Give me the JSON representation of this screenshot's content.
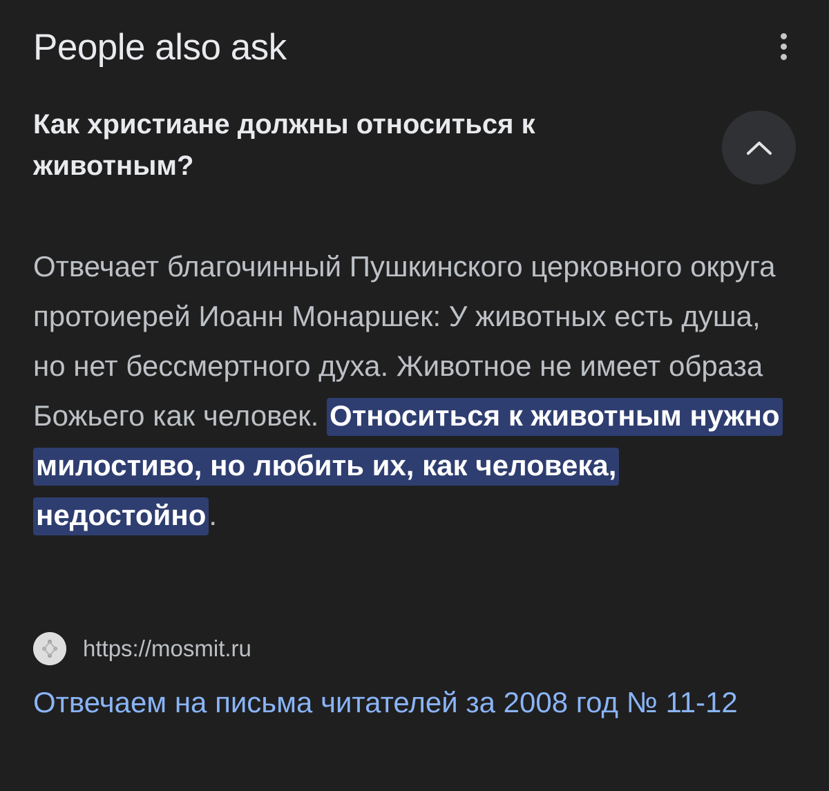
{
  "header": {
    "title": "People also ask",
    "more_icon": "more-vert-icon"
  },
  "question": {
    "text": "Как христиане должны относиться к животным?",
    "toggle_icon": "chevron-up-icon",
    "expanded": true
  },
  "answer": {
    "text_before": "Отвечает благочинный Пушкинского церковного округа протоиерей Иоанн Монаршек: У животных есть душа, но нет бессмертного духа. Животное не имеет образа Божьего как человек. ",
    "highlighted": "Относиться к животным нужно милостиво, но любить их, как человека, недостойно",
    "text_after": "."
  },
  "source": {
    "url": "https://mosmit.ru",
    "favicon_icon": "site-favicon-icon"
  },
  "result": {
    "title": "Отвечаем на письма читателей за 2008 год № 11-12"
  },
  "colors": {
    "background": "#1f1f1f",
    "highlight_bg": "#2f3e70",
    "link": "#8ab4f8",
    "button_bg": "#303134"
  }
}
